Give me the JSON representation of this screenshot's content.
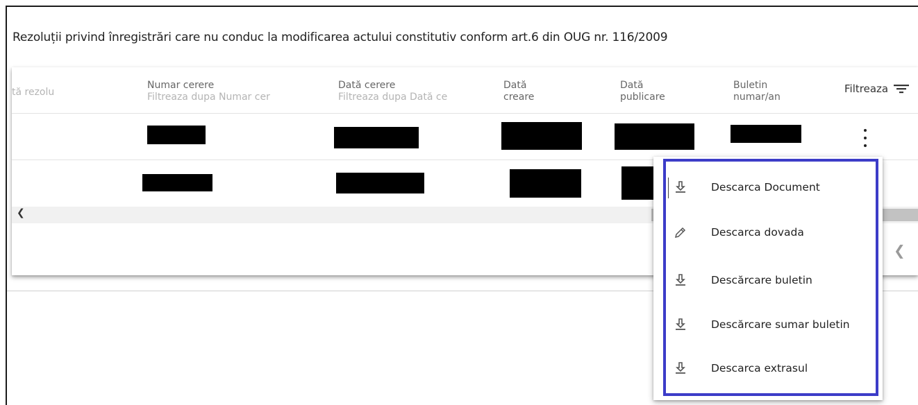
{
  "page_title": "Rezoluții privind înregistrări care nu conduc la modificarea actului constitutiv conform art.6 din OUG nr. 116/2009",
  "table": {
    "columns": [
      {
        "label": "",
        "filter": "tă rezolu"
      },
      {
        "label": "Numar cerere",
        "filter": "Filtreaza dupa Numar cer"
      },
      {
        "label": "Dată cerere",
        "filter": "Filtreaza dupa Dată ce"
      },
      {
        "label": "Dată",
        "label2": "creare"
      },
      {
        "label": "Dată",
        "label2": "publicare"
      },
      {
        "label": "Buletin",
        "label2": "numar/an"
      }
    ],
    "filter_button": "Filtreaza"
  },
  "context_menu": {
    "items": [
      {
        "label": "Descarca Document",
        "icon": "download-icon"
      },
      {
        "label": "Descarca dovada",
        "icon": "pencil-icon"
      },
      {
        "label": "Descărcare buletin",
        "icon": "download-icon"
      },
      {
        "label": "Descărcare sumar buletin",
        "icon": "download-icon"
      },
      {
        "label": "Descarca extrasul",
        "icon": "download-icon"
      }
    ]
  },
  "colors": {
    "menu_highlight": "#3c3cc8",
    "redaction": "#000000"
  }
}
